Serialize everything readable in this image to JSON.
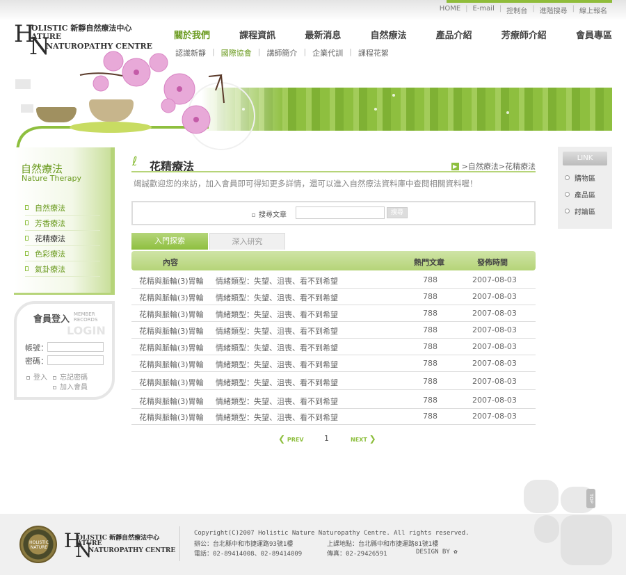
{
  "top_links": [
    "HOME",
    "E-mail",
    "控制台",
    "進階搜尋",
    "線上報名"
  ],
  "logo": {
    "big_h": "H",
    "big_n": "N",
    "line1": "OLISTIC 新靜自然療法中心",
    "line2": "ATURE",
    "line3": "NATUROPATHY CENTRE"
  },
  "main_nav": [
    "關於我們",
    "課程資訊",
    "最新消息",
    "自然療法",
    "產品介紹",
    "芳療師介紹",
    "會員專區"
  ],
  "sub_nav": [
    "認識新靜",
    "國際協會",
    "講師簡介",
    "企業代訓",
    "課程花絮"
  ],
  "sidebar": {
    "title": "自然療法",
    "subtitle": "Nature Therapy",
    "items": [
      "自然療法",
      "芳香療法",
      "花精療法",
      "色彩療法",
      "氣卦療法"
    ]
  },
  "login": {
    "title": "會員登入",
    "member_records": [
      "MEMBER",
      "RECORDS"
    ],
    "watermark": "LOGIN",
    "account_label": "帳號：",
    "password_label": "密碼：",
    "login_link": "登入",
    "forgot_link": "忘記密碼",
    "join_link": "加入會員"
  },
  "content": {
    "title": "花精療法",
    "breadcrumb": ">自然療法>花精療法",
    "welcome": "竭誠歡迎您的來訪，加入會員即可得知更多詳情，還可以進入自然療法資料庫中查閱相關資料喔！",
    "search_label": "搜尋文章",
    "search_button": "搜尋",
    "tabs": [
      "入門探索",
      "深入研究"
    ],
    "columns": [
      "內容",
      "熱門文章",
      "發佈時間"
    ],
    "rows": [
      {
        "title": "花精與脈輪(3)胃輪",
        "type": "情緒類型：失望、沮喪、看不到希望",
        "hits": "788",
        "date": "2007-08-03"
      },
      {
        "title": "花精與脈輪(3)胃輪",
        "type": "情緒類型：失望、沮喪、看不到希望",
        "hits": "788",
        "date": "2007-08-03"
      },
      {
        "title": "花精與脈輪(3)胃輪",
        "type": "情緒類型：失望、沮喪、看不到希望",
        "hits": "788",
        "date": "2007-08-03"
      },
      {
        "title": "花精與脈輪(3)胃輪",
        "type": "情緒類型：失望、沮喪、看不到希望",
        "hits": "788",
        "date": "2007-08-03"
      },
      {
        "title": "花精與脈輪(3)胃輪",
        "type": "情緒類型：失望、沮喪、看不到希望",
        "hits": "788",
        "date": "2007-08-03"
      },
      {
        "title": "花精與脈輪(3)胃輪",
        "type": "情緒類型：失望、沮喪、看不到希望",
        "hits": "788",
        "date": "2007-08-03"
      },
      {
        "title": "花精與脈輪(3)胃輪",
        "type": "情緒類型：失望、沮喪、看不到希望",
        "hits": "788",
        "date": "2007-08-03"
      },
      {
        "title": "花精與脈輪(3)胃輪",
        "type": "情緒類型：失望、沮喪、看不到希望",
        "hits": "788",
        "date": "2007-08-03"
      },
      {
        "title": "花精與脈輪(3)胃輪",
        "type": "情緒類型：失望、沮喪、看不到希望",
        "hits": "788",
        "date": "2007-08-03"
      }
    ],
    "pager": {
      "prev": "PREV",
      "page": "1",
      "next": "NEXT"
    }
  },
  "link_panel": {
    "title": "LINK",
    "items": [
      "購物區",
      "產品區",
      "討論區"
    ]
  },
  "top_button": "TOP",
  "footer": {
    "seal_text": "HOLISTIC NATURE",
    "copyright": "Copyright(C)2007 Holistic Nature Naturopathy Centre. All rights reserved.",
    "office": "辦公：台北縣中和市捷運路93號1樓",
    "class_location": "上課地點：台北縣中和市捷運路81號1樓",
    "phone": "電話：02-89414008、02-89414009",
    "fax": "傳真：02-29426591",
    "design_by": "DESIGN BY"
  },
  "colors": {
    "accent": "#8ebf3f",
    "accent_dark": "#6a9a1e",
    "flower": "#e8a9d8"
  }
}
